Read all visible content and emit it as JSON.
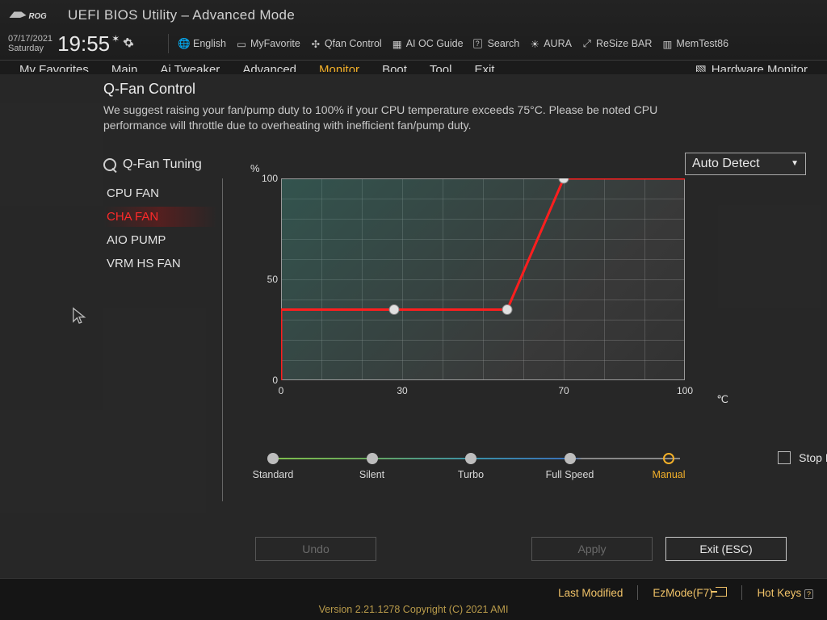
{
  "header": {
    "title": "UEFI BIOS Utility – Advanced Mode",
    "date": "07/17/2021",
    "day": "Saturday",
    "time": "19:55",
    "tools": {
      "language": "English",
      "favorite": "MyFavorite",
      "qfan": "Qfan Control",
      "aioc": "AI OC Guide",
      "search": "Search",
      "aura": "AURA",
      "resize": "ReSize BAR",
      "memtest": "MemTest86"
    }
  },
  "tabs": {
    "items": [
      "My Favorites",
      "Main",
      "Ai Tweaker",
      "Advanced",
      "Monitor",
      "Boot",
      "Tool",
      "Exit"
    ],
    "active_index": 4,
    "hwmon": "Hardware Monitor"
  },
  "panel": {
    "title": "Q-Fan Control",
    "desc": "We suggest raising your fan/pump duty to 100% if your CPU temperature exceeds 75°C. Please be noted CPU performance will throttle due to overheating with inefficient fan/pump duty.",
    "tuning_label": "Q-Fan Tuning",
    "fan_items": [
      "CPU FAN",
      "CHA FAN",
      "AIO PUMP",
      "VRM HS FAN"
    ],
    "active_fan_index": 1,
    "dropdown": "Auto Detect",
    "profiles": [
      "Standard",
      "Silent",
      "Turbo",
      "Full Speed",
      "Manual"
    ],
    "active_profile_index": 4,
    "stopfan_label": "Stop Fan",
    "buttons": {
      "undo": "Undo",
      "apply": "Apply",
      "exit": "Exit (ESC)"
    }
  },
  "footer": {
    "last_modified": "Last Modified",
    "ezmode": "EzMode(F7)",
    "hotkeys": "Hot Keys",
    "copyright": "Version 2.21.1278 Copyright (C) 2021 AMI"
  },
  "chart_data": {
    "type": "line",
    "xlabel": "℃",
    "ylabel": "%",
    "xlim": [
      0,
      100
    ],
    "ylim": [
      0,
      100
    ],
    "xticks": [
      0,
      30,
      70,
      100
    ],
    "yticks": [
      0,
      50,
      100
    ],
    "series": [
      {
        "name": "CHA FAN curve",
        "points": [
          {
            "x": 0,
            "y": 0
          },
          {
            "x": 0,
            "y": 35
          },
          {
            "x": 28,
            "y": 35
          },
          {
            "x": 56,
            "y": 35
          },
          {
            "x": 70,
            "y": 100
          },
          {
            "x": 100,
            "y": 100
          }
        ],
        "handles_at": [
          2,
          3,
          4
        ]
      }
    ],
    "color": "#ff1e1e"
  }
}
